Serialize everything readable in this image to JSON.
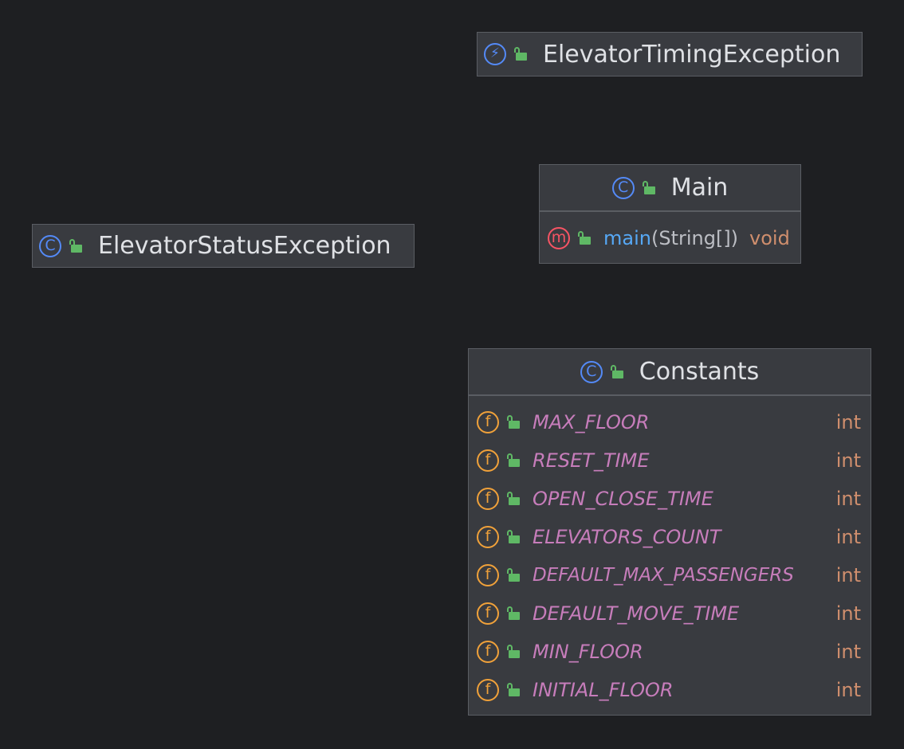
{
  "nodes": {
    "elevator_timing_exception": {
      "title": "ElevatorTimingException",
      "kind_icon": "exception-icon"
    },
    "elevator_status_exception": {
      "title": "ElevatorStatusException",
      "kind_icon": "class-icon"
    },
    "main": {
      "title": "Main",
      "kind_icon": "class-icon",
      "methods": [
        {
          "name": "main",
          "params": "(String[])",
          "return_type": "void"
        }
      ]
    },
    "constants": {
      "title": "Constants",
      "kind_icon": "class-icon",
      "fields": [
        {
          "name": "MAX_FLOOR",
          "type": "int"
        },
        {
          "name": "RESET_TIME",
          "type": "int"
        },
        {
          "name": "OPEN_CLOSE_TIME",
          "type": "int"
        },
        {
          "name": "ELEVATORS_COUNT",
          "type": "int"
        },
        {
          "name": "DEFAULT_MAX_PASSENGERS",
          "type": "int"
        },
        {
          "name": "DEFAULT_MOVE_TIME",
          "type": "int"
        },
        {
          "name": "MIN_FLOOR",
          "type": "int"
        },
        {
          "name": "INITIAL_FLOOR",
          "type": "int"
        }
      ]
    }
  },
  "icons": {
    "class_glyph": "C",
    "exception_glyph": "⚡",
    "method_glyph": "m",
    "field_glyph": "f"
  },
  "colors": {
    "background": "#1e1f22",
    "node_fill": "#393b40",
    "class_icon": "#548af7",
    "method_icon": "#f75464",
    "field_icon": "#f0a13a",
    "public_lock": "#5fb865",
    "field_name": "#c77dbb",
    "type": "#cf8e6d",
    "method_name": "#56a8f5"
  }
}
